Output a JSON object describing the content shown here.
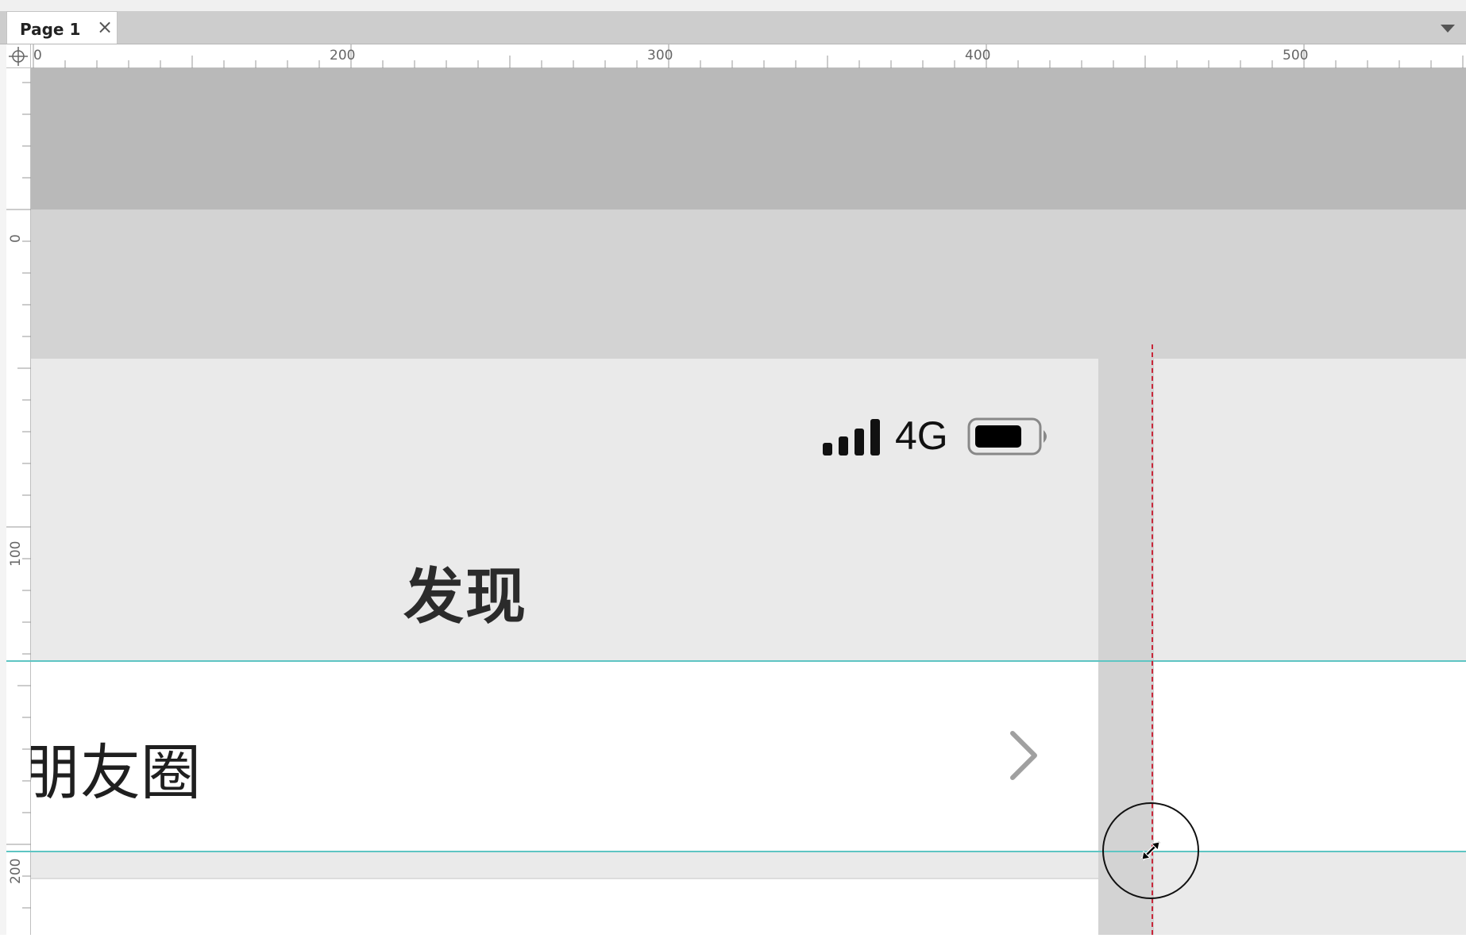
{
  "tabs": [
    {
      "label": "Page 1",
      "close_glyph": "×"
    }
  ],
  "tab_menu": {
    "icon": "chevron-down-icon"
  },
  "rulers": {
    "horizontal_labels": [
      "0",
      "200",
      "300",
      "400",
      "500"
    ],
    "vertical_labels": [
      "0",
      "100",
      "200"
    ]
  },
  "phone": {
    "status_bar": {
      "signal_icon": "signal-bars-icon",
      "network": "4G",
      "battery_icon": "battery-icon"
    },
    "title": "发现",
    "rows": [
      {
        "label": "朋友圈",
        "chevron_icon": "chevron-right-icon"
      }
    ]
  },
  "colors": {
    "guide": "#5ec5c3",
    "guide_vertical": "#c8273a",
    "canvas_dark_band": "#b9b9b9",
    "canvas_mid_band": "#d3d3d3",
    "canvas_light": "#eaeaea"
  }
}
